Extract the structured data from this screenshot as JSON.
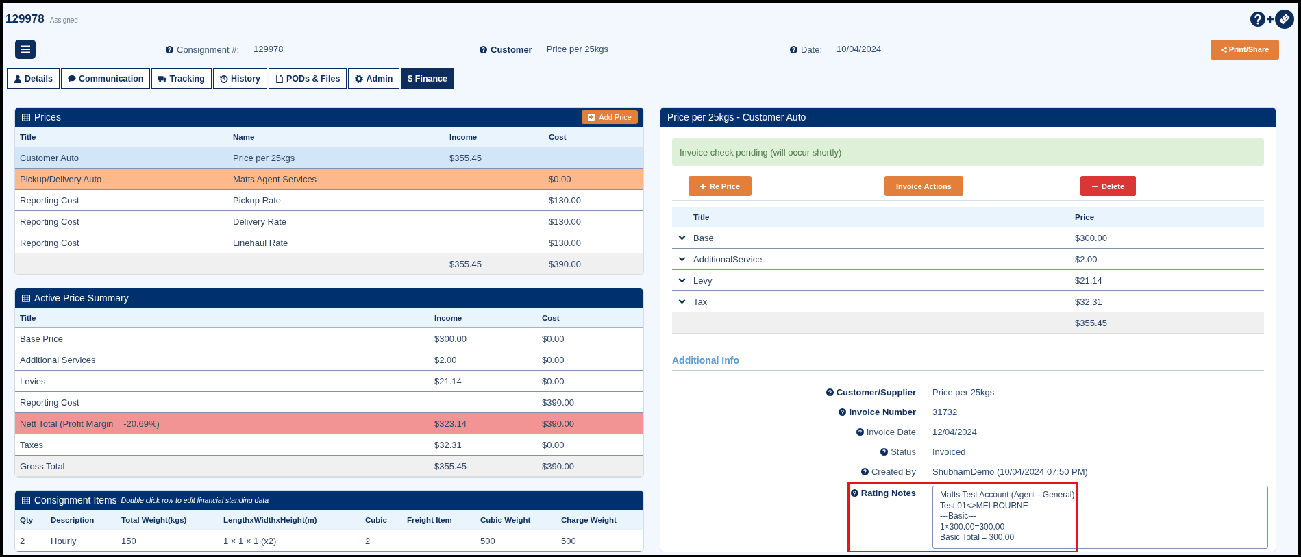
{
  "header": {
    "consignment_id": "129978",
    "status": "Assigned"
  },
  "fields": [
    {
      "label": "Consignment #:",
      "value": "129978",
      "bold": false
    },
    {
      "label": "Customer",
      "value": "Price per 25kgs",
      "bold": true
    },
    {
      "label": "Date:",
      "value": "10/04/2024",
      "bold": false
    }
  ],
  "print_button": "Print/Share",
  "tabs": [
    {
      "label": "Details",
      "selected": false
    },
    {
      "label": "Communication",
      "selected": false
    },
    {
      "label": "Tracking",
      "selected": false
    },
    {
      "label": "History",
      "selected": false
    },
    {
      "label": "PODs & Files",
      "selected": false
    },
    {
      "label": "Admin",
      "selected": false
    },
    {
      "label": "$ Finance",
      "selected": true
    }
  ],
  "prices": {
    "title": "Prices",
    "add_button": "Add Price",
    "columns": [
      "Title",
      "Name",
      "Income",
      "Cost"
    ],
    "rows": [
      {
        "kind": "active",
        "title": "Customer Auto",
        "name": "Price per 25kgs",
        "income": "$355.45"
      },
      {
        "kind": "agent",
        "title": "Pickup/Delivery Auto",
        "name": "Matts Agent Services",
        "cost": "$0.00"
      },
      {
        "kind": "plain",
        "title": "Reporting Cost",
        "name": "Pickup Rate",
        "cost": "$130.00"
      },
      {
        "kind": "plain",
        "title": "Reporting Cost",
        "name": "Delivery Rate",
        "cost": "$130.00"
      },
      {
        "kind": "plain",
        "title": "Reporting Cost",
        "name": "Linehaul Rate",
        "cost": "$130.00"
      },
      {
        "kind": "total",
        "income": "$355.45",
        "cost": "$390.00"
      }
    ]
  },
  "summary": {
    "title": "Active Price Summary",
    "columns": [
      "Title",
      "Income",
      "Cost"
    ],
    "rows": [
      {
        "kind": "plain",
        "title": "Base Price",
        "income": "$300.00",
        "cost": "$0.00"
      },
      {
        "kind": "plain",
        "title": "Additional Services",
        "income": "$2.00",
        "cost": "$0.00"
      },
      {
        "kind": "plain",
        "title": "Levies",
        "income": "$21.14",
        "cost": "$0.00"
      },
      {
        "kind": "plain",
        "title": "Reporting Cost",
        "cost": "$390.00"
      },
      {
        "kind": "loss",
        "title": "Nett Total (Profit Margin = -20.69%)",
        "income": "$323.14",
        "cost": "$390.00"
      },
      {
        "kind": "plain",
        "title": "Taxes",
        "income": "$32.31",
        "cost": "$0.00"
      },
      {
        "kind": "total",
        "title": "Gross Total",
        "income": "$355.45",
        "cost": "$390.00"
      }
    ]
  },
  "items": {
    "title": "Consignment Items",
    "hint": "Double click row to edit financial standing data",
    "columns": [
      "Qty",
      "Description",
      "Total Weight(kgs)",
      "LengthxWidthxHeight(m)",
      "Cubic",
      "Freight Item",
      "Cubic Weight",
      "Charge Weight"
    ],
    "rows": [
      {
        "cells": [
          "2",
          "Hourly",
          "150",
          "1 × 1 × 1 (x2)",
          "2",
          null,
          "500",
          "500"
        ]
      }
    ]
  },
  "detail": {
    "title": "Price per 25kgs - Customer Auto",
    "alert": "Invoice check pending (will occur shortly)",
    "buttons": [
      {
        "label": "Re Price",
        "kind": "add"
      },
      {
        "label": "Invoice Actions",
        "kind": "plain"
      },
      {
        "label": "Delete",
        "kind": "remove"
      }
    ],
    "columns": [
      "Title",
      "Price"
    ],
    "rows": [
      {
        "title": "Base",
        "price": "$300.00"
      },
      {
        "title": "AdditionalService",
        "price": "$2.00"
      },
      {
        "title": "Levy",
        "price": "$21.14"
      },
      {
        "title": "Tax",
        "price": "$32.31"
      }
    ],
    "total": "$355.45"
  },
  "additional_info": {
    "title": "Additional Info",
    "fields": [
      {
        "label": "Customer/Supplier",
        "value": "Price per 25kgs",
        "bold": true
      },
      {
        "label": "Invoice Number",
        "value": "31732",
        "bold": true
      },
      {
        "label": "Invoice Date",
        "value": "12/04/2024",
        "bold": false
      },
      {
        "label": "Status",
        "value": "Invoiced",
        "bold": false
      },
      {
        "label": "Created By",
        "value": "ShubhamDemo (10/04/2024 07:50 PM)",
        "bold": false
      }
    ],
    "rating_notes": {
      "label": "Rating Notes",
      "value": "Matts Test Account (Agent - General)\nTest 01<>MELBOURNE\n---Basic---\n1×300.00=300.00\nBasic Total = 300.00",
      "highlighted": true
    }
  }
}
